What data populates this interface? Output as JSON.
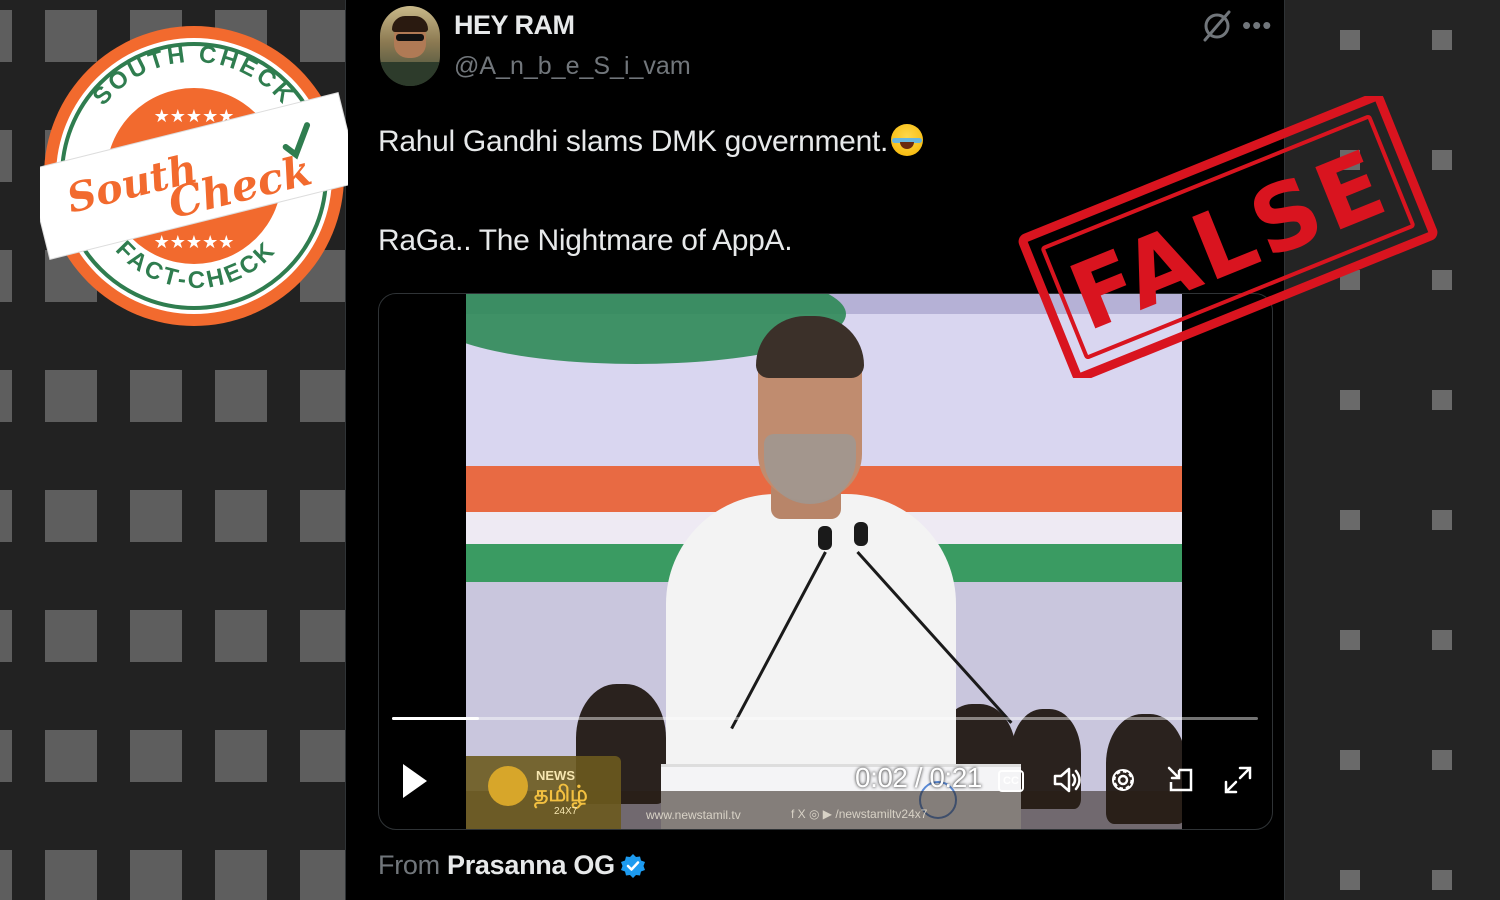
{
  "tweet": {
    "display_name": "HEY RAM",
    "handle": "@A_n_b_e_S_i_vam",
    "text_line1": "Rahul Gandhi slams DMK government.",
    "text_line2": "RaGa.. The Nightmare of AppA.",
    "emoji": "face-with-tears-of-joy"
  },
  "video": {
    "elapsed": "0:02",
    "separator": "/",
    "duration": "0:21",
    "progress_fraction": 0.1,
    "cc_label": "CC",
    "channel_news": "NEWS",
    "channel_name": "தமிழ்",
    "channel_tag": "24X7",
    "watermark_url": "www.newstamil.tv",
    "watermark_social": "f X ◎ ▶ /newstamiltv24x7"
  },
  "attribution": {
    "prefix": "From",
    "source_name": "Prasanna OG"
  },
  "branding": {
    "logo_top_arc": "SOUTH CHECK",
    "logo_bottom_arc": "FACT-CHECK",
    "logo_word1": "South",
    "logo_word2": "Check",
    "logo_stars": "★★★★★",
    "stamp_text": "FALSE"
  },
  "colors": {
    "panel_bg": "#000000",
    "text_primary": "#e7e9ea",
    "text_secondary": "#71767b",
    "logo_orange": "#f26a2e",
    "logo_green": "#2f7d4f",
    "stamp_red": "#d9141f",
    "verified_blue": "#1d9bf0"
  },
  "icons": [
    "grok-icon",
    "more-icon",
    "play-icon",
    "cc-icon",
    "volume-icon",
    "settings-gear-icon",
    "pip-minimize-icon",
    "fullscreen-icon",
    "verified-badge-icon"
  ]
}
